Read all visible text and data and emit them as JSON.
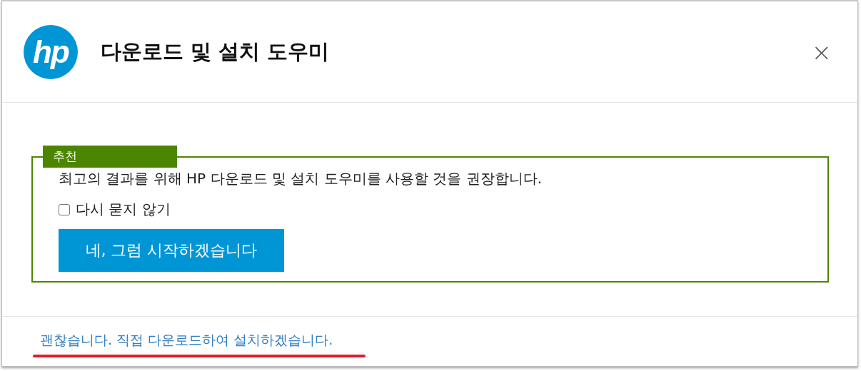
{
  "header": {
    "logo": "hp",
    "title": "다운로드 및 설치 도우미",
    "close": "×"
  },
  "recommendation": {
    "badge": "추천",
    "message": "최고의 결과를 위해 HP 다운로드 및 설치 도우미를 사용할 것을 권장합니다.",
    "checkbox": {
      "label": "다시 묻지 않기",
      "checked": false
    },
    "button": "네, 그럼 시작하겠습니다"
  },
  "footer": {
    "link": "괜찮습니다. 직접 다운로드하여 설치하겠습니다."
  }
}
